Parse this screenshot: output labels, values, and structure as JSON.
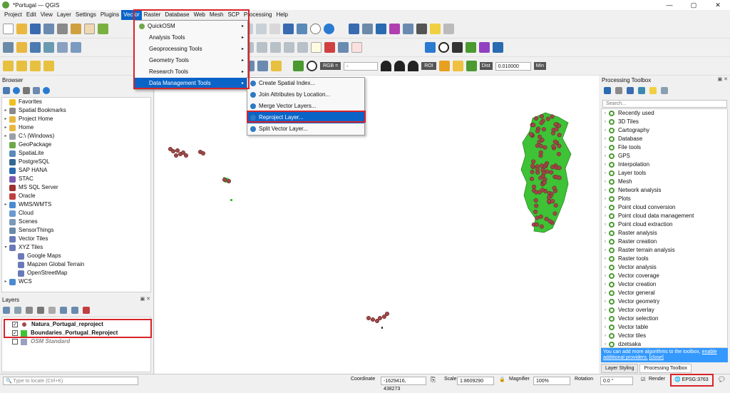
{
  "window": {
    "title": "*Portugal — QGIS",
    "min": "—",
    "max": "▢",
    "close": "✕"
  },
  "menubar": [
    "Project",
    "Edit",
    "View",
    "Layer",
    "Settings",
    "Plugins",
    "Vector",
    "Raster",
    "Database",
    "Web",
    "Mesh",
    "SCP",
    "Processing",
    "Help"
  ],
  "vector_menu": {
    "items": [
      "QuickOSM",
      "Analysis Tools",
      "Geoprocessing Tools",
      "Geometry Tools",
      "Research Tools",
      "Data Management Tools"
    ],
    "sub_arrow": "▸"
  },
  "data_management_menu": {
    "items": [
      "Create Spatial Index...",
      "Join Attributes by Location...",
      "Merge Vector Layers...",
      "Reproject Layer...",
      "Split Vector Layer..."
    ]
  },
  "toolbar3": {
    "rgb_label": "RGB =",
    "rgb_value": "-",
    "roi_label": "ROI",
    "dist_label": "Dist",
    "dist_value": "0.010000",
    "min_label": "Min"
  },
  "browser": {
    "title": "Browser",
    "items": [
      {
        "label": "Favorites",
        "icon": "star-icon",
        "color": "#f0c020",
        "arrow": ""
      },
      {
        "label": "Spatial Bookmarks",
        "icon": "bookmark-icon",
        "color": "#8a8a8a",
        "arrow": "▸"
      },
      {
        "label": "Project Home",
        "icon": "folder-icon",
        "color": "#e8b840",
        "arrow": "▸"
      },
      {
        "label": "Home",
        "icon": "folder-icon",
        "color": "#e8b840",
        "arrow": "▸"
      },
      {
        "label": "C:\\ (Windows)",
        "icon": "drive-icon",
        "color": "#9aa0a6",
        "arrow": "▸"
      },
      {
        "label": "GeoPackage",
        "icon": "geopackage-icon",
        "color": "#6fa84a",
        "arrow": ""
      },
      {
        "label": "SpatiaLite",
        "icon": "spatialite-icon",
        "color": "#5a8ab8",
        "arrow": ""
      },
      {
        "label": "PostgreSQL",
        "icon": "postgresql-icon",
        "color": "#336791",
        "arrow": ""
      },
      {
        "label": "SAP HANA",
        "icon": "database-icon",
        "color": "#2a6ab0",
        "arrow": ""
      },
      {
        "label": "STAC",
        "icon": "stac-icon",
        "color": "#7a5ab0",
        "arrow": ""
      },
      {
        "label": "MS SQL Server",
        "icon": "database-icon",
        "color": "#a03030",
        "arrow": ""
      },
      {
        "label": "Oracle",
        "icon": "database-icon",
        "color": "#c04040",
        "arrow": ""
      },
      {
        "label": "WMS/WMTS",
        "icon": "globe-icon",
        "color": "#4a8ad0",
        "arrow": "▸"
      },
      {
        "label": "Cloud",
        "icon": "cloud-icon",
        "color": "#6a9ad0",
        "arrow": ""
      },
      {
        "label": "Scenes",
        "icon": "scenes-icon",
        "color": "#7a9ab8",
        "arrow": ""
      },
      {
        "label": "SensorThings",
        "icon": "sensor-icon",
        "color": "#6a8aa8",
        "arrow": ""
      },
      {
        "label": "Vector Tiles",
        "icon": "grid-icon",
        "color": "#6a7ab8",
        "arrow": ""
      },
      {
        "label": "XYZ Tiles",
        "icon": "grid-icon",
        "color": "#6a7ab8",
        "arrow": "▾"
      },
      {
        "label": "Google Maps",
        "icon": "grid-icon",
        "color": "#6a7ab8",
        "arrow": "",
        "indent": true
      },
      {
        "label": "Mapzen Global Terrain",
        "icon": "grid-icon",
        "color": "#6a7ab8",
        "arrow": "",
        "indent": true
      },
      {
        "label": "OpenStreetMap",
        "icon": "grid-icon",
        "color": "#6a7ab8",
        "arrow": "",
        "indent": true
      },
      {
        "label": "WCS",
        "icon": "globe-icon",
        "color": "#4a8ad0",
        "arrow": "▸"
      }
    ]
  },
  "layers": {
    "title": "Layers",
    "items": [
      {
        "label": "Natura_Portugal_reproject",
        "checked": "✓",
        "swatch": "#a04848",
        "shape": "dot"
      },
      {
        "label": "Boundaries_Portugal_Reproject",
        "checked": "✓",
        "swatch": "#3ec236",
        "shape": "square"
      },
      {
        "label": "OSM Standard",
        "checked": "",
        "swatch": "#9aa0c0",
        "shape": "grid"
      }
    ]
  },
  "processing": {
    "title": "Processing Toolbox",
    "search_placeholder": "Search...",
    "items": [
      "Recently used",
      "3D Tiles",
      "Cartography",
      "Database",
      "File tools",
      "GPS",
      "Interpolation",
      "Layer tools",
      "Mesh",
      "Network analysis",
      "Plots",
      "Point cloud conversion",
      "Point cloud data management",
      "Point cloud extraction",
      "Raster analysis",
      "Raster creation",
      "Raster terrain analysis",
      "Raster tools",
      "Vector analysis",
      "Vector coverage",
      "Vector creation",
      "Vector general",
      "Vector geometry",
      "Vector overlay",
      "Vector selection",
      "Vector table",
      "Vector tiles",
      "dzetsaka"
    ],
    "info_text": "You can add more algorithms to the toolbox,",
    "info_link1": "enable additional providers.",
    "info_link2": "[close]",
    "tabs": [
      "Layer Styling",
      "Processing Toolbox"
    ]
  },
  "statusbar": {
    "locate_placeholder": "Type to locate (Ctrl+K)",
    "coordinate_label": "Coordinate",
    "coordinate_value": "-1629416, 438273",
    "scale_label": "Scale",
    "scale_value": "1:8609290",
    "magnifier_label": "Magnifier",
    "magnifier_value": "100%",
    "rotation_label": "Rotation",
    "rotation_value": "0.0 °",
    "render_label": "Render",
    "crs": "EPSG:3763"
  },
  "colors": {
    "accent": "#0a64c8",
    "highlight_box": "#d8232a",
    "country_fill": "#3ec236",
    "site_fill": "#a04848"
  }
}
